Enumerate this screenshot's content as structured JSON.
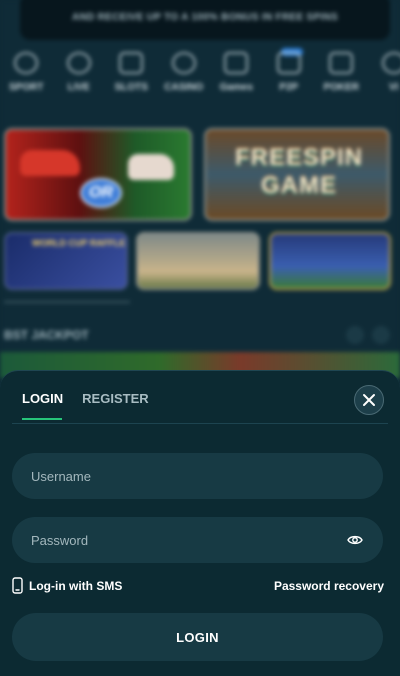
{
  "background": {
    "promo_text": "AND RECEIVE UP TO A 100% BONUS IN FREE SPINS",
    "nav": [
      {
        "label": "SPORT",
        "icon": "soccer-ball-icon"
      },
      {
        "label": "LIVE",
        "icon": "live-signal-icon"
      },
      {
        "label": "SLOTS",
        "icon": "slot-machine-icon"
      },
      {
        "label": "CASINO",
        "icon": "casino-chip-icon"
      },
      {
        "label": "Games",
        "icon": "games-icon"
      },
      {
        "label": "P2P",
        "icon": "p2p-icon"
      },
      {
        "label": "POKER",
        "icon": "poker-dice-icon"
      },
      {
        "label": "VI",
        "icon": "vip-icon"
      }
    ],
    "tiles": {
      "freespin_title": "FREESPIN GAME",
      "or_text": "OR",
      "worldcup_text": "WORLD CUP RAFFLE"
    },
    "jackpot_title": "BST JACKPOT"
  },
  "login": {
    "tabs": {
      "login": "LOGIN",
      "register": "REGISTER"
    },
    "username_placeholder": "Username",
    "password_placeholder": "Password",
    "sms_label": "Log-in with SMS",
    "recovery_label": "Password recovery",
    "submit_label": "LOGIN"
  },
  "colors": {
    "sheet_bg": "#0c2a32",
    "field_bg": "#173a44",
    "accent": "#27c47a"
  }
}
